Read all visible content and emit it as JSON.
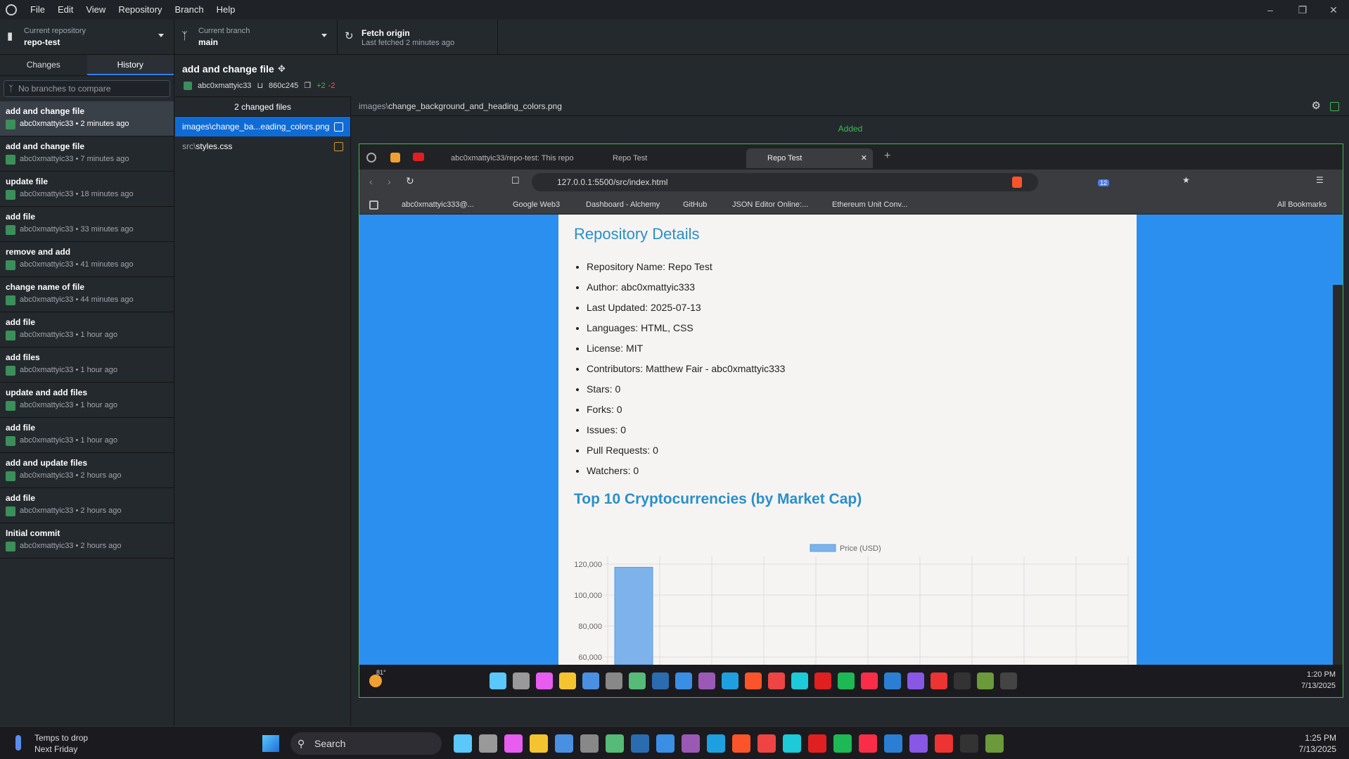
{
  "menu": [
    "File",
    "Edit",
    "View",
    "Repository",
    "Branch",
    "Help"
  ],
  "toolbar": {
    "repo_label": "Current repository",
    "repo_value": "repo-test",
    "branch_label": "Current branch",
    "branch_value": "main",
    "fetch_label": "Fetch origin",
    "fetch_sub": "Last fetched 2 minutes ago"
  },
  "tabs": {
    "changes": "Changes",
    "history": "History"
  },
  "compare_placeholder": "No branches to compare",
  "commits": [
    {
      "title": "add and change file",
      "meta": "abc0xmattyic33 • 2 minutes ago"
    },
    {
      "title": "add and change file",
      "meta": "abc0xmattyic33 • 7 minutes ago"
    },
    {
      "title": "update file",
      "meta": "abc0xmattyic33 • 18 minutes ago"
    },
    {
      "title": "add file",
      "meta": "abc0xmattyic33 • 33 minutes ago"
    },
    {
      "title": "remove and add",
      "meta": "abc0xmattyic33 • 41 minutes ago"
    },
    {
      "title": "change name of file",
      "meta": "abc0xmattyic33 • 44 minutes ago"
    },
    {
      "title": "add file",
      "meta": "abc0xmattyic33 • 1 hour ago"
    },
    {
      "title": "add files",
      "meta": "abc0xmattyic33 • 1 hour ago"
    },
    {
      "title": "update and add files",
      "meta": "abc0xmattyic33 • 1 hour ago"
    },
    {
      "title": "add file",
      "meta": "abc0xmattyic33 • 1 hour ago"
    },
    {
      "title": "add and update files",
      "meta": "abc0xmattyic33 • 2 hours ago"
    },
    {
      "title": "add file",
      "meta": "abc0xmattyic33 • 2 hours ago"
    },
    {
      "title": "Initial commit",
      "meta": "abc0xmattyic33 • 2 hours ago"
    }
  ],
  "commit_detail": {
    "title": "add and change file",
    "author": "abc0xmattyic33",
    "sha": "860c245",
    "added": "+2",
    "removed": "-2"
  },
  "changed_files_label": "2 changed files",
  "files": [
    {
      "dir": "",
      "name": "images\\change_ba...eading_colors.png",
      "status": "added",
      "color": "#ffffff"
    },
    {
      "dir": "src\\",
      "name": "styles.css",
      "status": "modified",
      "color": "#d29922"
    }
  ],
  "diff": {
    "dir": "images\\",
    "file": "change_background_and_heading_colors.png",
    "status": "Added"
  },
  "browser": {
    "tabs": [
      "abc0xmattyic33/repo-test: This repo",
      "Repo Test",
      "Repo Test"
    ],
    "url": "127.0.0.1:5500/src/index.html",
    "bookmarks": [
      "abc0xmattyic333@...",
      "Google Web3",
      "Dashboard - Alchemy",
      "GitHub",
      "JSON Editor Online:...",
      "Ethereum Unit Conv..."
    ],
    "all_bookmarks": "All Bookmarks",
    "ext_badge": "12"
  },
  "webpage": {
    "details_title": "Repository Details",
    "details": [
      "Repository Name: Repo Test",
      "Author: abc0xmattyic333",
      "Last Updated: 2025-07-13",
      "Languages: HTML, CSS",
      "License: MIT",
      "Contributors: Matthew Fair - abc0xmattyic333",
      "Stars: 0",
      "Forks: 0",
      "Issues: 0",
      "Pull Requests: 0",
      "Watchers: 0"
    ],
    "chart_title": "Top 10 Cryptocurrencies (by Market Cap)"
  },
  "chart_data": {
    "type": "bar",
    "series": [
      {
        "name": "Price (USD)",
        "values": [
          118000
        ]
      }
    ],
    "categories": [
      "",
      "",
      "",
      "",
      "",
      "",
      "",
      "",
      "",
      ""
    ],
    "yticks": [
      "120,000",
      "100,000",
      "80,000",
      "60,000"
    ],
    "ylim": [
      55000,
      125000
    ],
    "legend": "top",
    "color": "#7db3ea"
  },
  "inner_taskbar": {
    "weather": "81°",
    "time": "1:20 PM",
    "date": "7/13/2025"
  },
  "taskbar": {
    "weather_title": "Temps to drop",
    "weather_sub": "Next Friday",
    "search": "Search",
    "time": "1:25 PM",
    "date": "7/13/2025"
  }
}
